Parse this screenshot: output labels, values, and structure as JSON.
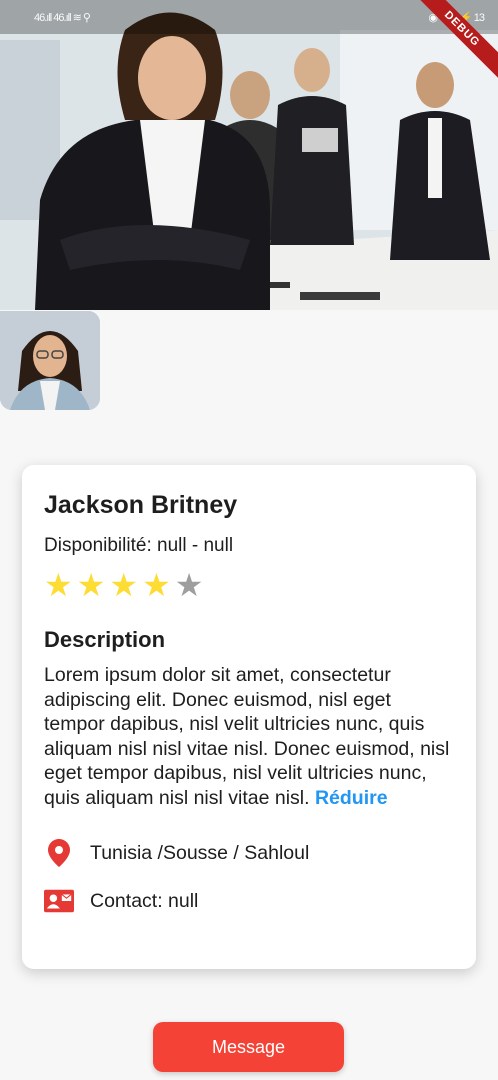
{
  "status_bar": {
    "left_glyphs": "46.ıll 46.ıll ≋ ⚲",
    "right_glyphs": "◉ ◔ 43 ⚡ 13"
  },
  "debug_label": "DEBUG",
  "profile": {
    "name": "Jackson Britney",
    "availability": "Disponibilité: null - null",
    "rating": 4,
    "rating_max": 5
  },
  "description": {
    "title": "Description",
    "text": "Lorem ipsum dolor sit amet, consectetur adipiscing elit. Donec euismod, nisl eget tempor dapibus, nisl velit ultricies nunc, quis aliquam nisl nisl vitae nisl. Donec euismod, nisl eget tempor dapibus, nisl velit ultricies nunc, quis aliquam nisl nisl vitae nisl.",
    "collapse_label": "Réduire"
  },
  "location": "Tunisia /Sousse / Sahloul",
  "contact": "Contact: null",
  "message_button": "Message",
  "colors": {
    "accent_red": "#f44336",
    "icon_red": "#e53935",
    "link_blue": "#2196f3",
    "star_on": "#fddc33",
    "star_off": "#9e9e9e"
  }
}
